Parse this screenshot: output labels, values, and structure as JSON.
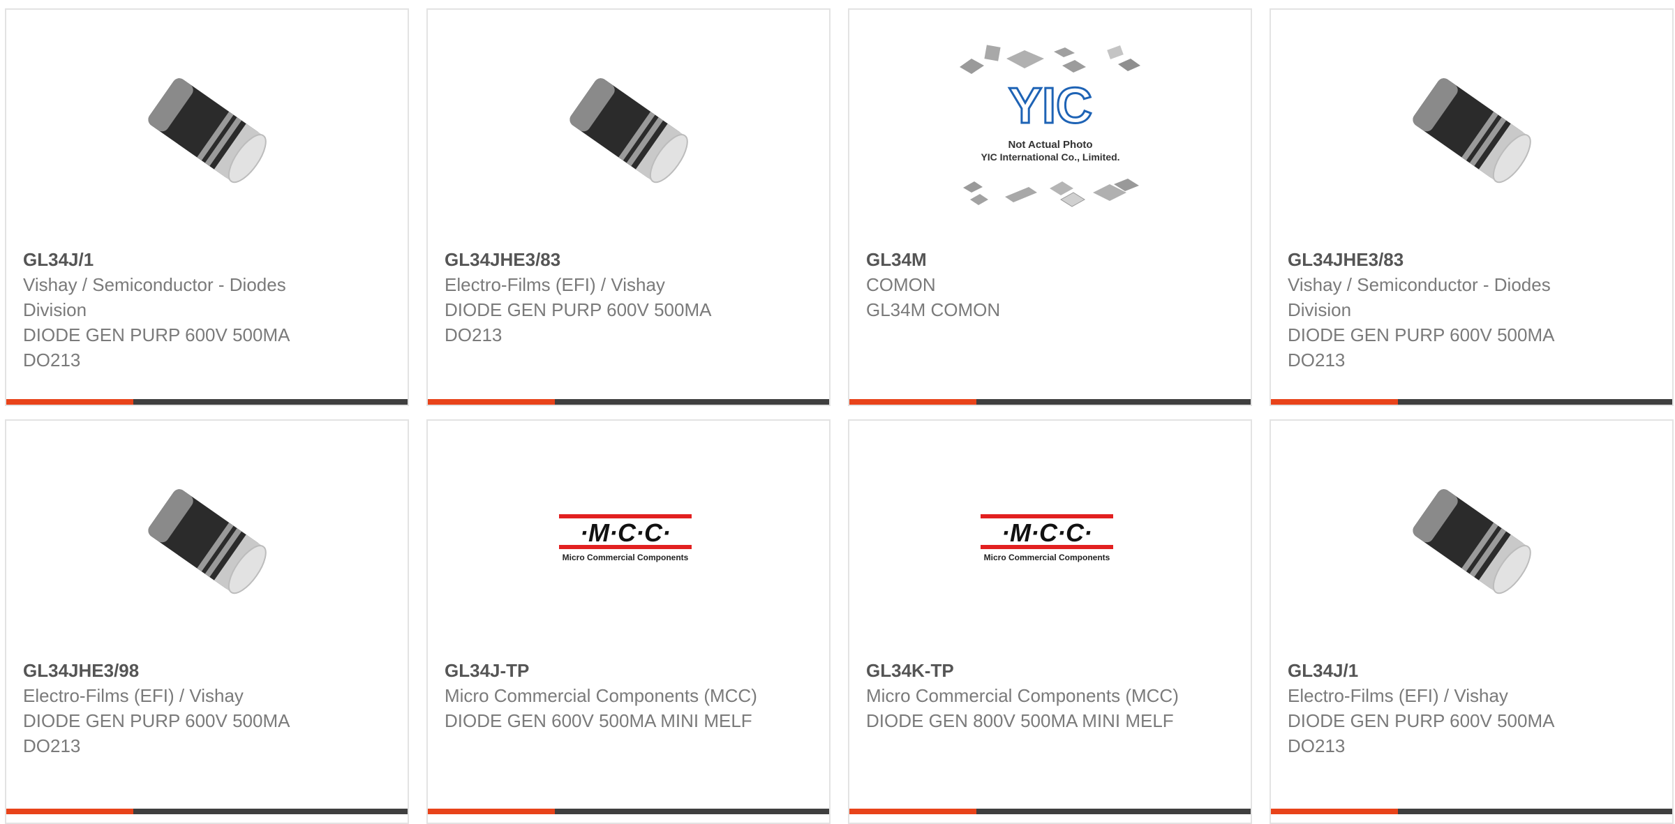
{
  "products": [
    {
      "part": "GL34J/1",
      "manufacturer": "Vishay / Semiconductor - Diodes Division",
      "description": "DIODE GEN PURP 600V 500MA DO213",
      "image": "diode-melf-image"
    },
    {
      "part": "GL34JHE3/83",
      "manufacturer": "Electro-Films (EFI) / Vishay",
      "description": "DIODE GEN PURP 600V 500MA DO213",
      "image": "diode-melf-image"
    },
    {
      "part": "GL34M",
      "manufacturer": "COMON",
      "description": "GL34M COMON",
      "image": "yic-placeholder-image",
      "image_text": {
        "logo": "YIC",
        "line1": "Not Actual Photo",
        "line2": "YIC International Co., Limited."
      }
    },
    {
      "part": "GL34JHE3/83",
      "manufacturer": "Vishay / Semiconductor - Diodes Division",
      "description": "DIODE GEN PURP 600V 500MA DO213",
      "image": "diode-melf-image"
    },
    {
      "part": "GL34JHE3/98",
      "manufacturer": "Electro-Films (EFI) / Vishay",
      "description": "DIODE GEN PURP 600V 500MA DO213",
      "image": "diode-melf-image"
    },
    {
      "part": "GL34J-TP",
      "manufacturer": "Micro Commercial Components (MCC)",
      "description": "DIODE GEN 600V 500MA MINI MELF",
      "image": "mcc-logo-image",
      "image_text": {
        "logo": "·M·C·C·",
        "sub": "Micro Commercial Components"
      }
    },
    {
      "part": "GL34K-TP",
      "manufacturer": "Micro Commercial Components (MCC)",
      "description": "DIODE GEN 800V 500MA MINI MELF",
      "image": "mcc-logo-image",
      "image_text": {
        "logo": "·M·C·C·",
        "sub": "Micro Commercial Components"
      }
    },
    {
      "part": "GL34J/1",
      "manufacturer": "Electro-Films (EFI) / Vishay",
      "description": "DIODE GEN PURP 600V 500MA DO213",
      "image": "diode-melf-image"
    }
  ],
  "colors": {
    "accent": "#e8431a",
    "bar": "#3f3f3f",
    "border": "#e3e3e3",
    "text": "#7a7a7a",
    "title": "#555555"
  }
}
